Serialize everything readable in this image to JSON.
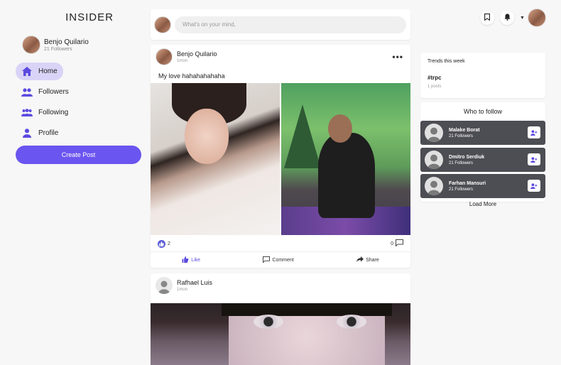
{
  "app": {
    "brand": "INSIDER"
  },
  "profile": {
    "name": "Benjo Quilario",
    "followers": "21 Followers"
  },
  "nav": [
    {
      "label": "Home",
      "icon": "home-icon",
      "active": true
    },
    {
      "label": "Followers",
      "icon": "users-icon",
      "active": false
    },
    {
      "label": "Following",
      "icon": "users-following-icon",
      "active": false
    },
    {
      "label": "Profile",
      "icon": "user-icon",
      "active": false
    }
  ],
  "create_post_label": "Create Post",
  "composer": {
    "placeholder": "What's on your mind,"
  },
  "posts": [
    {
      "author": "Benjo Quilario",
      "time": "1mon",
      "caption": "My love hahahahahaha",
      "likes": "2",
      "comments": "0",
      "actions": {
        "like": "Like",
        "comment": "Comment",
        "share": "Share"
      }
    },
    {
      "author": "Rafhael Luis",
      "time": "1mon"
    }
  ],
  "trends": {
    "title": "Trends this week",
    "tag": "#trpc",
    "count": "1 posts"
  },
  "who_to_follow": {
    "title": "Who to follow",
    "users": [
      {
        "name": "Malake Borat",
        "followers": "21 Followers"
      },
      {
        "name": "Dmitro Serdiuk",
        "followers": "21 Followers"
      },
      {
        "name": "Farhan Mansuri",
        "followers": "21 Followers"
      }
    ],
    "load_more": "Load More"
  },
  "colors": {
    "accent": "#6a55f0",
    "nav_active_bg": "#d9d4f7",
    "follow_card_bg": "#4d4d54"
  }
}
